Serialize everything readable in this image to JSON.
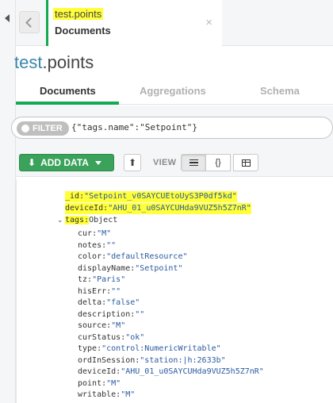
{
  "window": {
    "tab_title": "test.points",
    "tab_subtitle": "Documents",
    "close_glyph": "×"
  },
  "namespace": {
    "db": "test",
    "collection": ".points"
  },
  "subtabs": [
    "Documents",
    "Aggregations",
    "Schema"
  ],
  "filter": {
    "label": "FILTER",
    "query": "{\"tags.name\":\"Setpoint\"}"
  },
  "toolbar": {
    "add_data_label": "ADD DATA",
    "view_label": "VIEW",
    "view_buttons": [
      "list-icon",
      "json-icon",
      "table-icon"
    ],
    "json_glyph": "{}",
    "export_glyph": "⬆"
  },
  "document": {
    "top_fields": [
      {
        "key": "_id",
        "value": "\"Setpoint_v0SAYCUEtoUyS3P0df5kd\""
      },
      {
        "key": "deviceId",
        "value": "\"AHU_01_u0SAYCUHda9VUZ5h5Z7nR\""
      },
      {
        "key": "tags",
        "value": "Object"
      }
    ],
    "tag_fields": [
      {
        "key": "cur",
        "value": "\"M\""
      },
      {
        "key": "notes",
        "value": "\"\""
      },
      {
        "key": "color",
        "value": "\"defaultResource\""
      },
      {
        "key": "displayName",
        "value": "\"Setpoint\""
      },
      {
        "key": "tz",
        "value": "\"Paris\""
      },
      {
        "key": "hisErr",
        "value": "\"\""
      },
      {
        "key": "delta",
        "value": "\"false\""
      },
      {
        "key": "description",
        "value": "\"\""
      },
      {
        "key": "source",
        "value": "\"M\""
      },
      {
        "key": "curStatus",
        "value": "\"ok\""
      },
      {
        "key": "type",
        "value": "\"control:NumericWritable\""
      },
      {
        "key": "ordInSession",
        "value": "\"station:|h:2633b\""
      },
      {
        "key": "deviceId",
        "value": "\"AHU_01_u0SAYCUHda9VUZ5h5Z7nR\""
      },
      {
        "key": "point",
        "value": "\"M\""
      },
      {
        "key": "writable",
        "value": "\"M\""
      }
    ]
  },
  "colors": {
    "accent_green": "#13aa52",
    "highlight_yellow": "#ffff3a",
    "db_blue": "#3b86a8",
    "value_blue": "#2b5aa0"
  }
}
